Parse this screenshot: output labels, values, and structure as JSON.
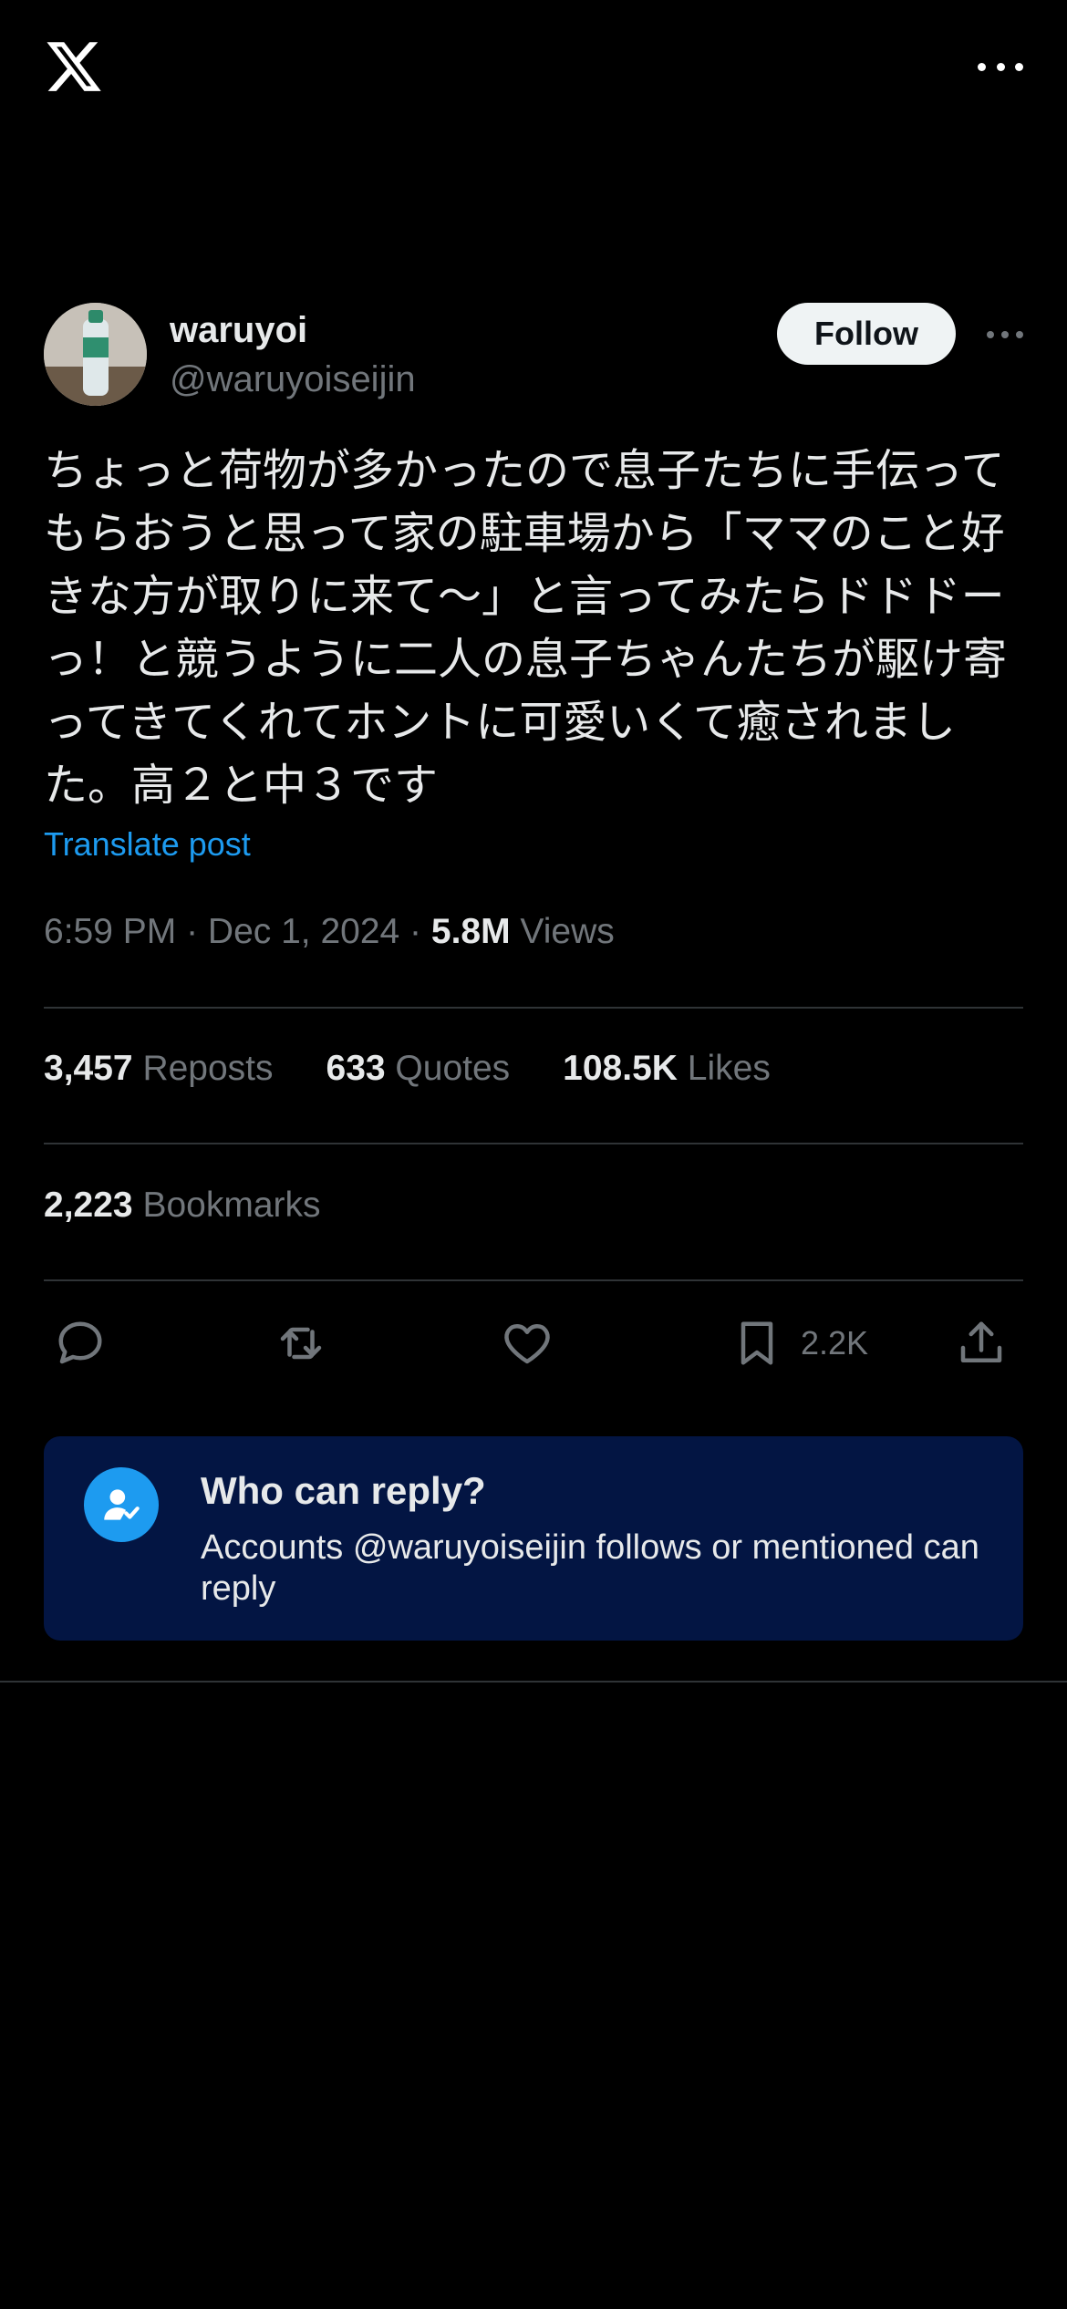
{
  "header": {
    "logo_icon": "x-logo-icon",
    "more_icon": "more-horizontal-icon"
  },
  "author": {
    "name": "waruyoi",
    "handle": "@waruyoiseijin",
    "follow_label": "Follow"
  },
  "post": {
    "text": "ちょっと荷物が多かったので息子たちに手伝って\nもらおうと思って家の駐車場から「ママのこと好\nきな方が取りに来て〜」と言ってみたらドドドー\nっ！と競うように二人の息子ちゃんたちが駆け寄\nってきてくれてホントに可愛いくて癒されまし\nた。高２と中３です",
    "translate_label": "Translate post",
    "time": "6:59 PM · Dec 1, 2024 · ",
    "views_count": "5.8M",
    "views_label": " Views"
  },
  "stats": {
    "reposts_count": "3,457",
    "reposts_label": " Reposts",
    "quotes_count": "633",
    "quotes_label": " Quotes",
    "likes_count": "108.5K",
    "likes_label": " Likes",
    "bookmarks_count": "2,223",
    "bookmarks_label": " Bookmarks"
  },
  "actions": {
    "reply_icon": "reply-icon",
    "repost_icon": "repost-icon",
    "like_icon": "heart-icon",
    "bookmark_icon": "bookmark-icon",
    "bookmark_count": "2.2K",
    "share_icon": "share-icon"
  },
  "reply_settings": {
    "title": "Who can reply?",
    "description": "Accounts @waruyoiseijin follows or mentioned can reply",
    "icon": "user-check-icon"
  },
  "colors": {
    "accent": "#1d9bf0",
    "background": "#000000",
    "muted": "#71767b",
    "reply_box": "#031543"
  }
}
